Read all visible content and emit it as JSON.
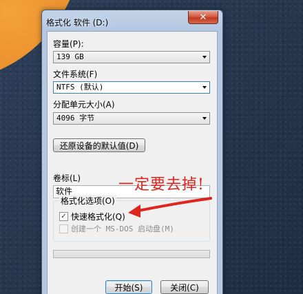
{
  "window": {
    "title": "格式化 软件 (D:)",
    "close_glyph": "✕"
  },
  "capacity": {
    "label": "容量(P):",
    "value": "139 GB"
  },
  "filesystem": {
    "label": "文件系统(F)",
    "value": "NTFS (默认)"
  },
  "allocation": {
    "label": "分配单元大小(A)",
    "value": "4096 字节"
  },
  "restore_button": "还原设备的默认值(D)",
  "volume": {
    "label": "卷标(L)",
    "value": "软件"
  },
  "options": {
    "title": "格式化选项(O)",
    "quick_format": {
      "label": "快速格式化(Q)",
      "checked": true
    },
    "msdos_disk": {
      "label": "创建一个 MS-DOS 启动盘(M)",
      "checked": false,
      "disabled": true
    }
  },
  "progress": {
    "fraction": 0
  },
  "buttons": {
    "start": "开始(S)",
    "close": "关闭(C)"
  },
  "annotation": {
    "text": "一定要去掉!",
    "color": "#e0251e"
  },
  "icons": {
    "close": "close-icon",
    "dropdown": "chevron-down-icon",
    "check": "checkmark-icon"
  }
}
